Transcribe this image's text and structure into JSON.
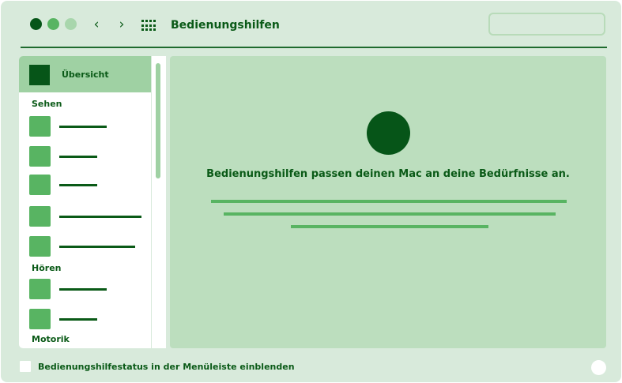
{
  "window": {
    "title": "Bedienungshilfen",
    "search": {
      "placeholder": "",
      "value": ""
    },
    "traffic_lights": [
      "close-button",
      "minimize-button",
      "zoom-button"
    ],
    "nav": {
      "back_icon": "chevron-left-icon",
      "forward_icon": "chevron-right-icon",
      "grid_icon": "show-all-grid-icon"
    }
  },
  "sidebar": {
    "header": {
      "label": "Übersicht"
    },
    "sections": [
      {
        "label": "Sehen"
      },
      {
        "label": "Hören"
      },
      {
        "label": "Motorik"
      }
    ]
  },
  "main": {
    "heading": "Bedienungshilfen passen deinen Mac an deine Bedürfnisse an."
  },
  "footer": {
    "checkbox_label": "Bedienungshilfestatus in der Menüleiste einblenden",
    "checkbox_checked": false
  },
  "colors": {
    "accent_dark": "#065518",
    "accent_mid": "#58b462",
    "accent_light": "#9fd1a3",
    "window_bg": "#d8eadb",
    "panel_bg": "#bcdebe"
  }
}
